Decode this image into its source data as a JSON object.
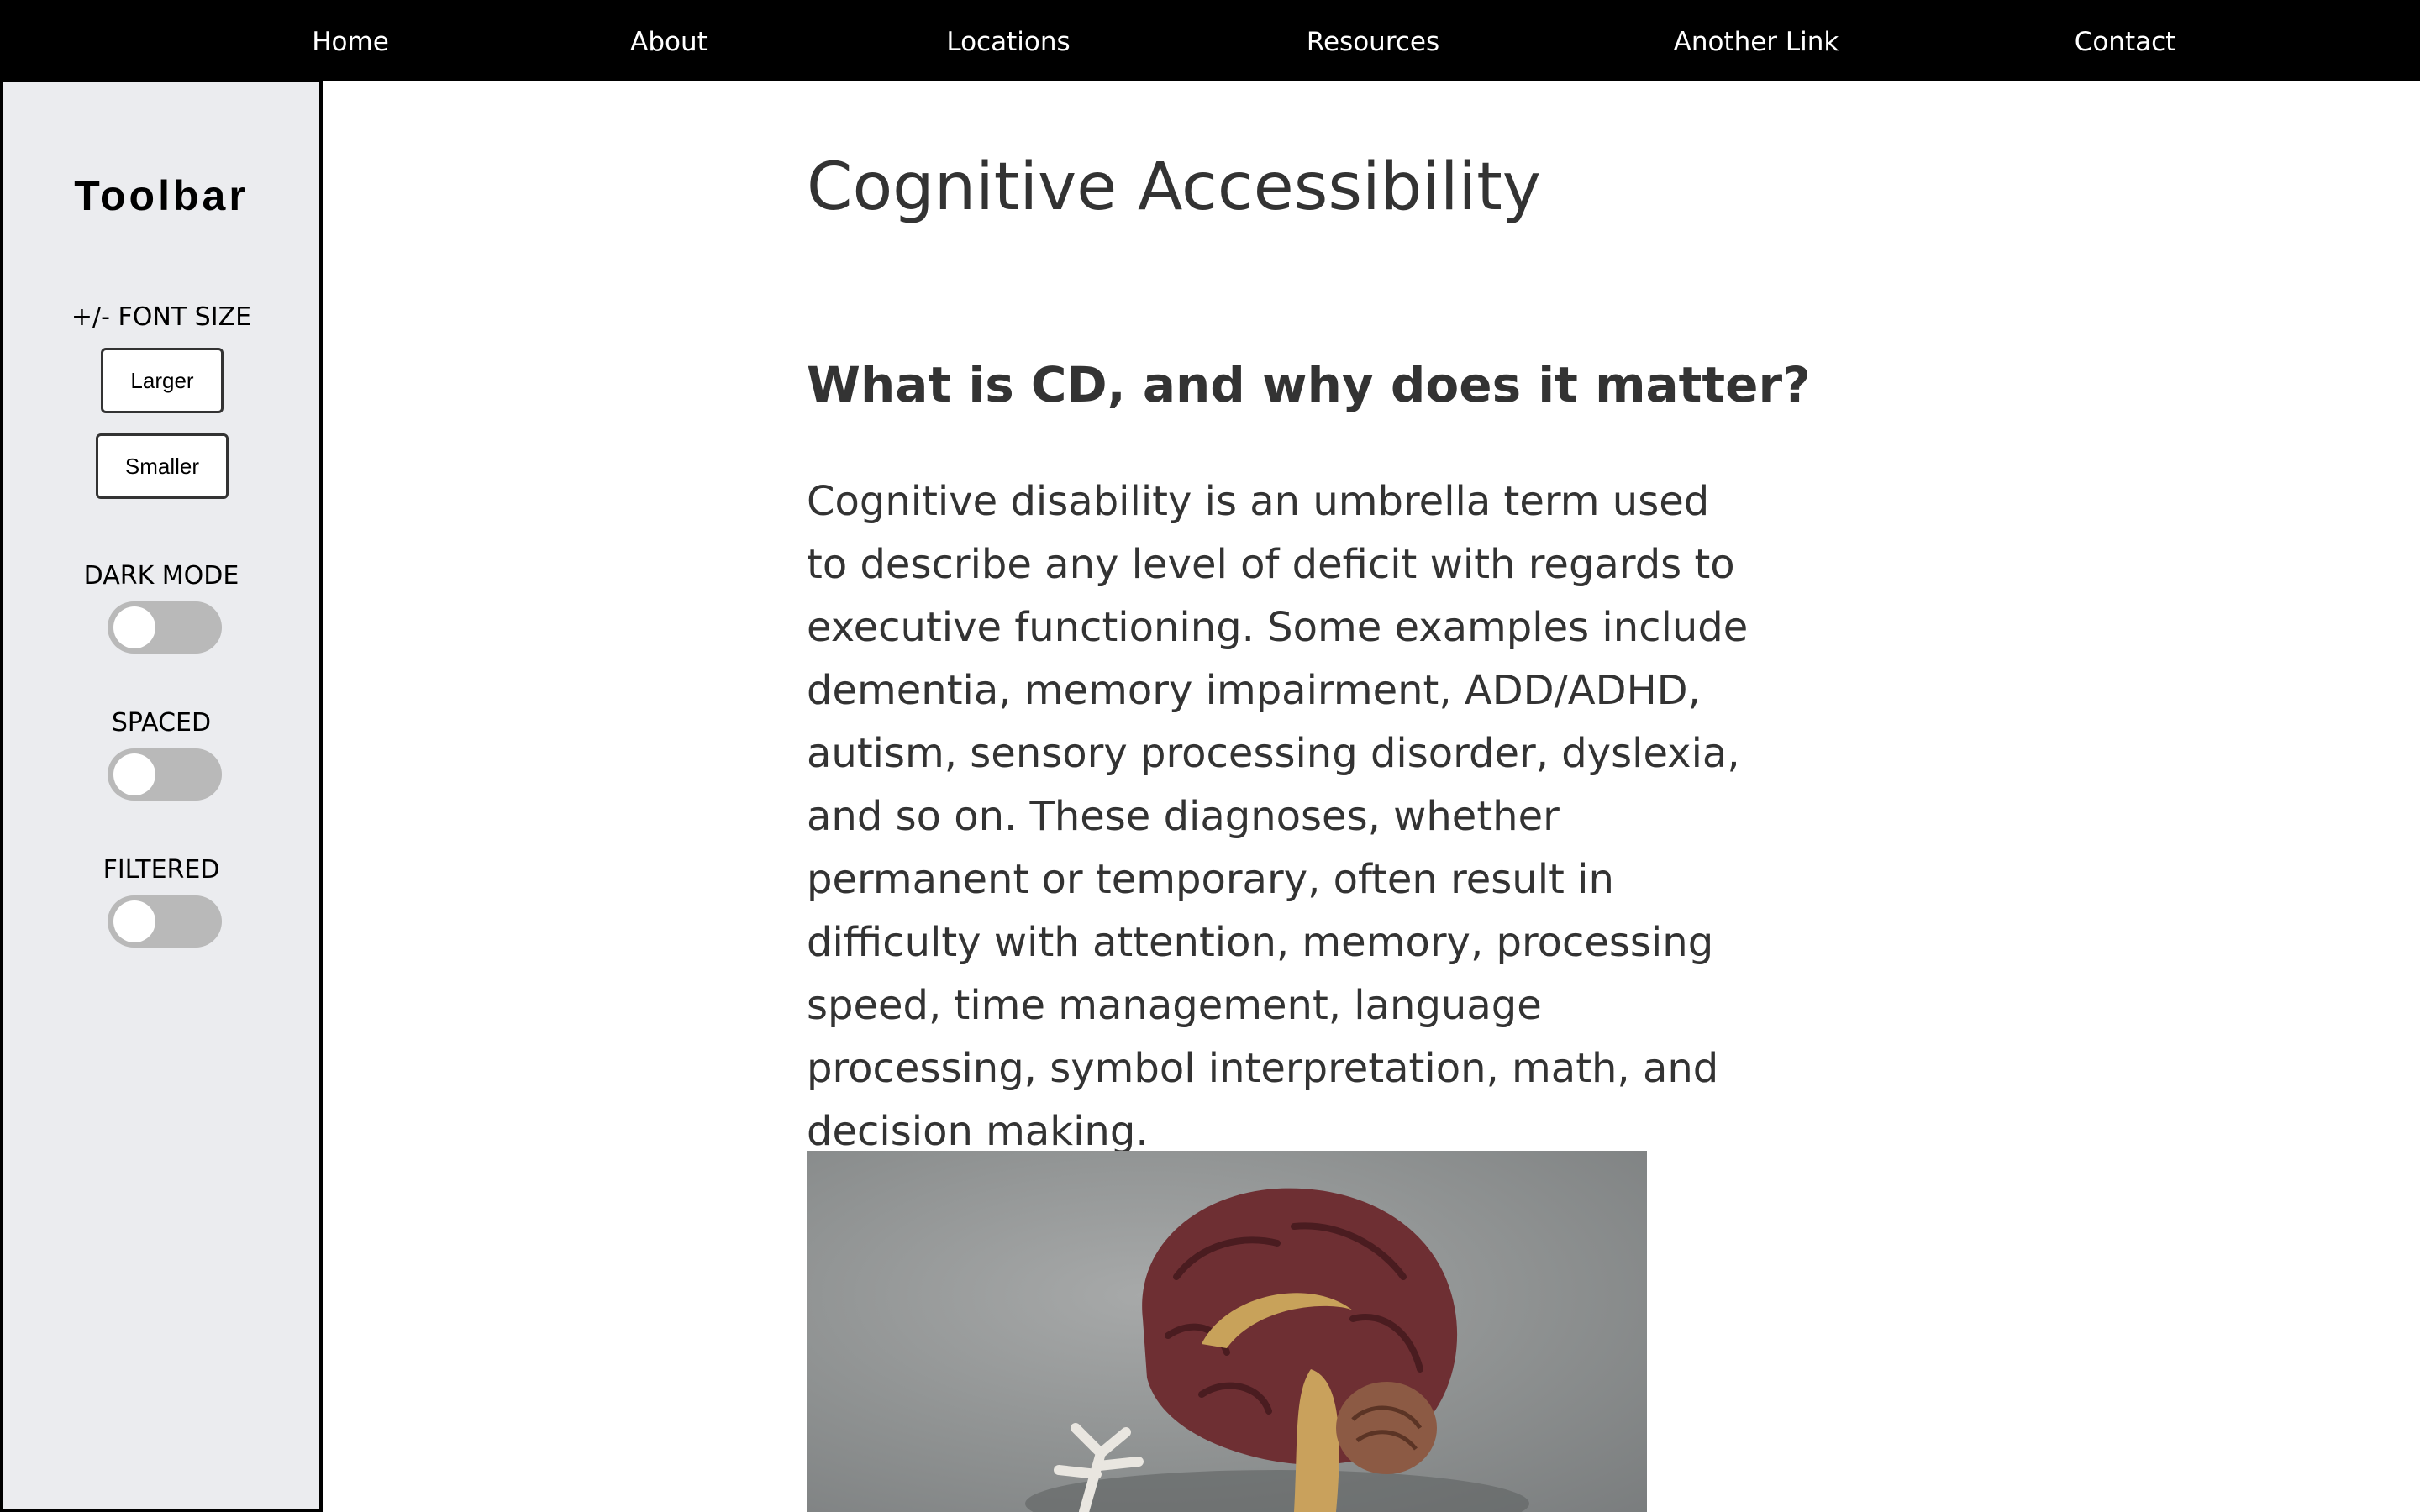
{
  "nav": {
    "items": [
      {
        "label": "Home"
      },
      {
        "label": "About"
      },
      {
        "label": "Locations"
      },
      {
        "label": "Resources"
      },
      {
        "label": "Another Link"
      },
      {
        "label": "Contact"
      }
    ]
  },
  "toolbar": {
    "title": "Toolbar",
    "font_size_label": "+/- FONT SIZE",
    "larger_label": "Larger",
    "smaller_label": "Smaller",
    "dark_mode": {
      "label": "DARK MODE",
      "on": false
    },
    "spaced": {
      "label": "SPACED",
      "on": false
    },
    "filtered": {
      "label": "FILTERED",
      "on": false
    }
  },
  "main": {
    "title": "Cognitive Accessibility",
    "heading": "What is CD, and why does it matter?",
    "paragraph": "Cognitive disability is an umbrella term used to describe any level of deficit with regards to executive functioning. Some examples include dementia, memory impairment, ADD/ADHD, autism, sensory processing disorder, dyslexia, and so on. These diagnoses, whether permanent or temporary, often result in difficulty with attention, memory, processing speed, time management, language processing, symbol interpretation, math, and decision making.",
    "image_subject": "brain model photo"
  },
  "colors": {
    "nav_bg": "#000000",
    "sidebar_bg": "#ebecef",
    "text": "#333333",
    "toggle_off": "#b9b9b9"
  }
}
